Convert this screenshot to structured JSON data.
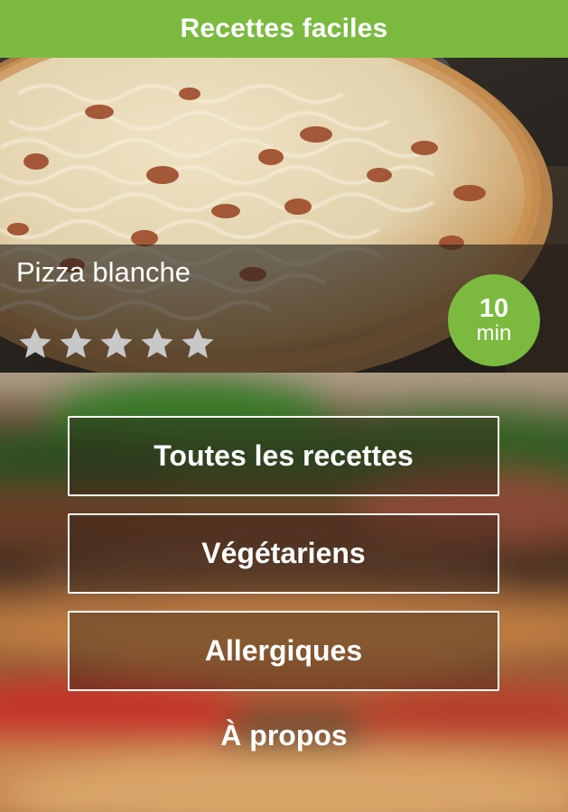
{
  "header": {
    "title": "Recettes faciles",
    "color": "#7bba3f"
  },
  "featured": {
    "recipe_name": "Pizza blanche",
    "rating": {
      "value": 5,
      "max": 5,
      "filled_color": "#c8c8c8"
    },
    "time": {
      "value": "10",
      "unit": "min"
    },
    "image_icon": "pizza-photo"
  },
  "menu": {
    "items": [
      {
        "label": "Toutes les recettes"
      },
      {
        "label": "Végétariens"
      },
      {
        "label": "Allergiques"
      }
    ],
    "about_label": "À propos",
    "background_icon": "blurred-sandwich-photo"
  },
  "colors": {
    "accent": "#7bba3f",
    "text": "#ffffff"
  }
}
